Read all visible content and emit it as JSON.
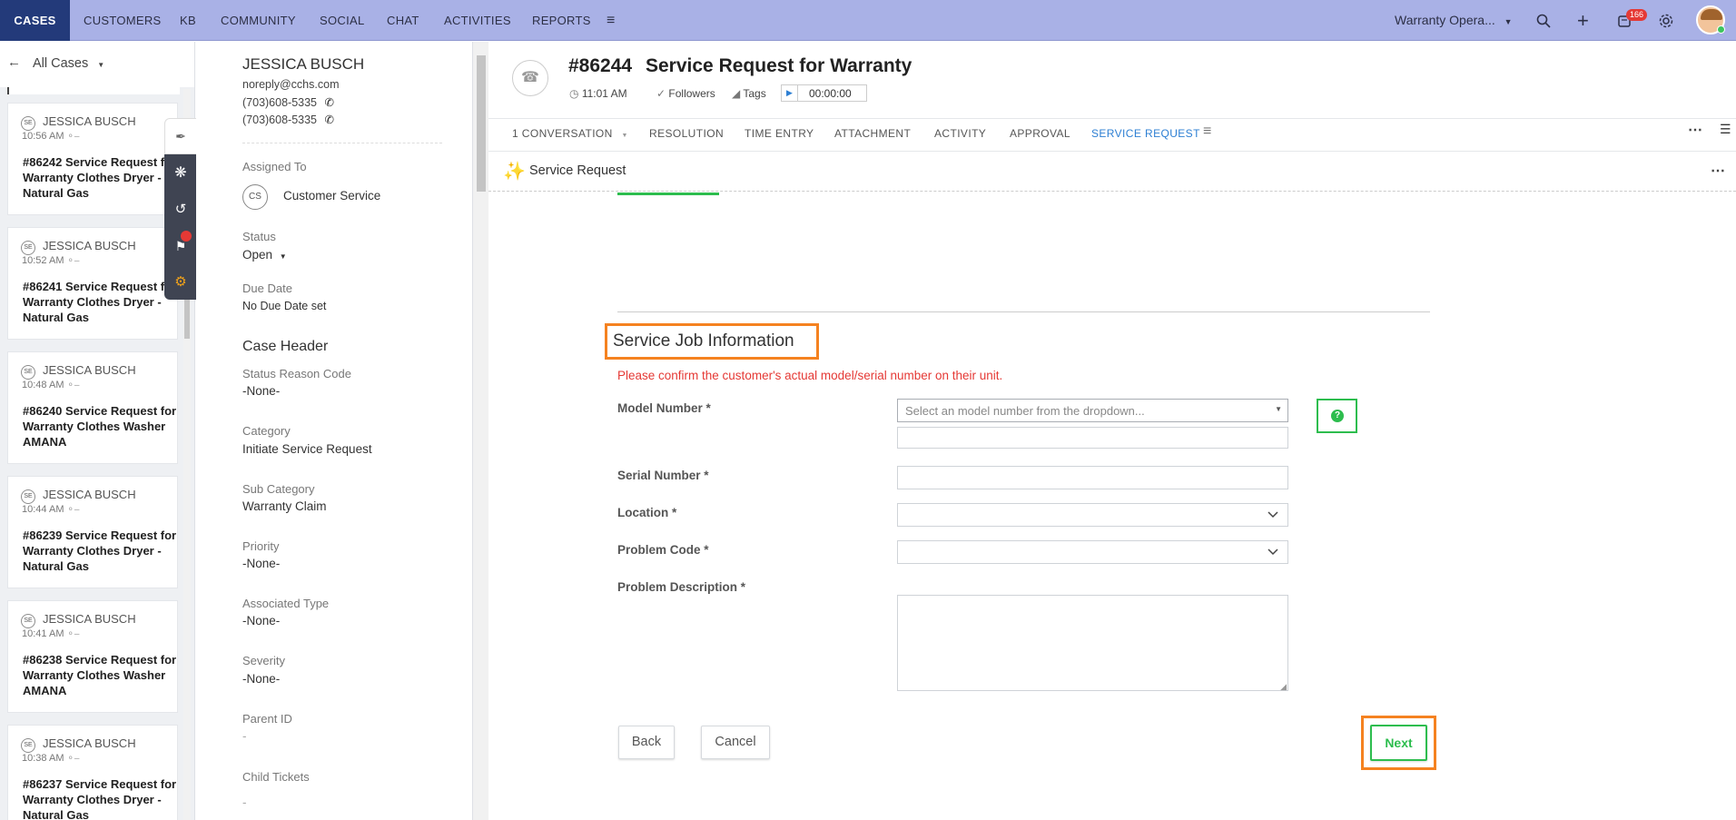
{
  "nav": {
    "tabs": [
      "CASES",
      "CUSTOMERS",
      "KB",
      "COMMUNITY",
      "SOCIAL",
      "CHAT",
      "ACTIVITIES",
      "REPORTS"
    ],
    "dept": "Warranty Opera...",
    "notif_count": "166"
  },
  "list": {
    "header": "All Cases",
    "cards": [
      {
        "initials": "SE",
        "name": "JESSICA BUSCH",
        "time": "10:56 AM",
        "title": "#86242   Service Request for Warranty Clothes Dryer - Natural Gas"
      },
      {
        "initials": "SE",
        "name": "JESSICA BUSCH",
        "time": "10:52 AM",
        "title": "#86241   Service Request for Warranty Clothes Dryer - Natural Gas"
      },
      {
        "initials": "SE",
        "name": "JESSICA BUSCH",
        "time": "10:48 AM",
        "title": "#86240   Service Request for Warranty Clothes Washer AMANA"
      },
      {
        "initials": "SE",
        "name": "JESSICA BUSCH",
        "time": "10:44 AM",
        "title": "#86239   Service Request for Warranty Clothes Dryer - Natural Gas"
      },
      {
        "initials": "SE",
        "name": "JESSICA BUSCH",
        "time": "10:41 AM",
        "title": "#86238   Service Request for Warranty Clothes Washer AMANA"
      },
      {
        "initials": "SE",
        "name": "JESSICA BUSCH",
        "time": "10:38 AM",
        "title": "#86237   Service Request for Warranty Clothes Dryer - Natural Gas"
      }
    ]
  },
  "contact": {
    "name": "JESSICA BUSCH",
    "email": "noreply@cchs.com",
    "phone1": "(703)608-5335",
    "phone2": "(703)608-5335",
    "assigned_label": "Assigned To",
    "assigned_initials": "CS",
    "assigned_value": "Customer Service",
    "status_label": "Status",
    "status_value": "Open",
    "due_label": "Due Date",
    "due_value": "No Due Date set",
    "section": "Case Header",
    "reason_label": "Status Reason Code",
    "reason_value": "-None-",
    "category_label": "Category",
    "category_value": "Initiate Service Request",
    "subcat_label": "Sub Category",
    "subcat_value": "Warranty Claim",
    "priority_label": "Priority",
    "priority_value": "-None-",
    "assoc_label": "Associated Type",
    "assoc_value": "-None-",
    "severity_label": "Severity",
    "severity_value": "-None-",
    "parent_label": "Parent ID",
    "parent_value": "-",
    "child_label": "Child Tickets",
    "child_value": "-"
  },
  "ticket": {
    "number": "#86244",
    "subject": "Service Request for Warranty",
    "time": "11:01 AM",
    "followers": "Followers",
    "tags": "Tags",
    "timer": "00:00:00"
  },
  "tabs": [
    "1 CONVERSATION",
    "RESOLUTION",
    "TIME ENTRY",
    "ATTACHMENT",
    "ACTIVITY",
    "APPROVAL",
    "SERVICE REQUEST"
  ],
  "panel": {
    "title": "Service Request"
  },
  "form": {
    "heading": "Service Job Information",
    "warning": "Please confirm the customer's actual model/serial number on their unit.",
    "model_label": "Model Number *",
    "model_placeholder": "Select an model number from the dropdown...",
    "serial_label": "Serial Number *",
    "location_label": "Location *",
    "problem_code_label": "Problem Code *",
    "problem_desc_label": "Problem Description *",
    "back": "Back",
    "cancel": "Cancel",
    "next": "Next"
  },
  "colors": {
    "nav_bg": "#a9b1e6",
    "nav_active": "#233a7a",
    "accent_green": "#2dbd4e",
    "highlight_orange": "#f58220",
    "warning_red": "#e53935",
    "tab_active": "#2d7fd3"
  }
}
